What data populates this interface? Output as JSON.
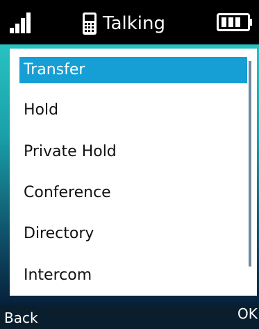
{
  "status_bar": {
    "title": "Talking",
    "signal_icon": "signal-strength-icon",
    "handset_icon": "handset-icon",
    "battery_icon": "battery-icon"
  },
  "menu": {
    "items": [
      {
        "label": "Transfer",
        "selected": true
      },
      {
        "label": "Hold",
        "selected": false
      },
      {
        "label": "Private Hold",
        "selected": false
      },
      {
        "label": "Conference",
        "selected": false
      },
      {
        "label": "Directory",
        "selected": false
      },
      {
        "label": "Intercom",
        "selected": false
      }
    ]
  },
  "softkeys": {
    "left": "Back",
    "right": "OK"
  },
  "colors": {
    "selection": "#169fd4",
    "scrollbar": "#6f8aa4",
    "gradient_top": "#27c2c0",
    "gradient_bottom": "#07203a"
  }
}
